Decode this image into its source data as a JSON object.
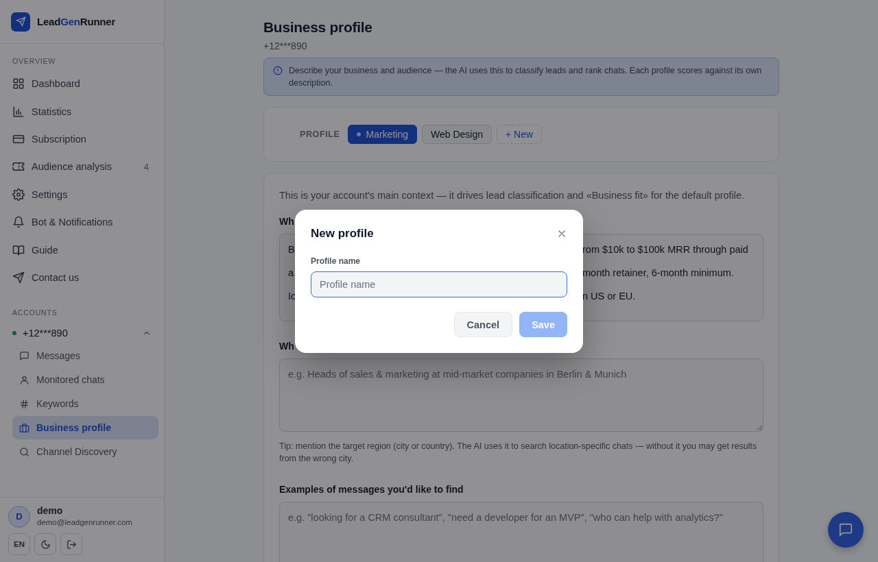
{
  "brand": {
    "start": "Lead",
    "accent": "Gen",
    "end": "Runner"
  },
  "sidebar": {
    "heading": "OVERVIEW",
    "items": [
      {
        "label": "Dashboard",
        "selected": false
      },
      {
        "label": "Statistics",
        "selected": false
      },
      {
        "label": "Subscription",
        "selected": false
      },
      {
        "label": "Audience analysis",
        "badge": "4",
        "selected": false
      },
      {
        "label": "Settings",
        "selected": false
      },
      {
        "label": "Bot & Notifications",
        "selected": false
      },
      {
        "label": "Guide",
        "selected": false
      },
      {
        "label": "Contact us",
        "selected": false
      }
    ]
  },
  "accounts": {
    "heading": "ACCOUNTS",
    "account": {
      "name": "+12***890",
      "online": true,
      "expanded": true,
      "items": [
        {
          "label": "Messages",
          "selected": false
        },
        {
          "label": "Monitored chats",
          "selected": false
        },
        {
          "label": "Keywords",
          "selected": false
        },
        {
          "label": "Business profile",
          "selected": true
        },
        {
          "label": "Channel Discovery",
          "selected": false
        }
      ]
    }
  },
  "user": {
    "initial": "D",
    "name": "demo",
    "email": "demo@leadgenrunner.com",
    "language": "EN"
  },
  "page": {
    "title": "Business profile",
    "subtitle": "+12***890",
    "info": "Describe your business and audience — the AI uses this to classify leads and rank chats. Each profile scores against its own description."
  },
  "profiles": {
    "label": "PROFILE",
    "items": [
      {
        "label": "Marketing",
        "selected": true
      },
      {
        "label": "Web Design",
        "selected": false
      }
    ],
    "add_label": "+ New"
  },
  "form": {
    "intro": "This is your account's main context — it drives lead classification and «Business fit» for the default profile.",
    "fields": [
      {
        "label": "Wh",
        "lines": [
          {
            "left": "B",
            "right": "rom $10k to $100k MRR through paid"
          },
          {
            "left": "a",
            "right": "month retainer, 6-month minimum."
          },
          {
            "left": "Ic",
            "right": "n US or EU."
          }
        ]
      },
      {
        "label": "Wh",
        "placeholder": "e.g. Heads of sales & marketing at mid-market companies in Berlin & Munich",
        "hint": "Tip: mention the target region (city or country). The AI uses it to search location-specific chats — without it you may get results from the wrong city."
      },
      {
        "label": "Examples of messages you'd like to find",
        "placeholder": "e.g. \"looking for a CRM consultant\", \"need a developer for an MVP\", \"who can help with analytics?\""
      }
    ]
  },
  "dialog": {
    "title": "New profile",
    "field_label": "Profile name",
    "placeholder": "Profile name",
    "cancel": "Cancel",
    "save": "Save",
    "save_disabled": true
  }
}
